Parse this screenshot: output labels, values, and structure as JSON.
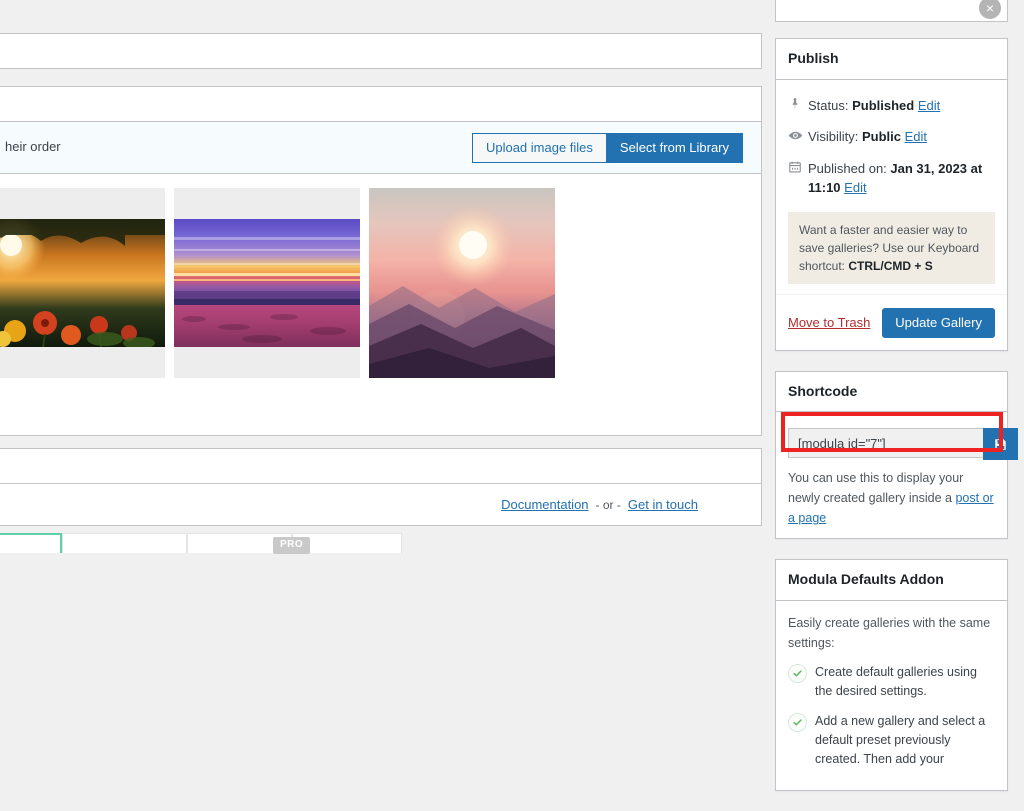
{
  "main": {
    "uploader": {
      "hint": "heir order",
      "upload_button": "Upload image files",
      "library_button": "Select from Library"
    },
    "gallery": {
      "images": [
        {
          "alt": "sunflowers-at-sunset"
        },
        {
          "alt": "beach-sunset-panorama"
        },
        {
          "alt": "mountain-sunset"
        }
      ]
    },
    "footer_links": {
      "documentation": "Documentation",
      "separator": "- or -",
      "contact": "Get in touch"
    },
    "tabs": {
      "pro_badge": "PRO"
    }
  },
  "sidebar": {
    "publish": {
      "title": "Publish",
      "rows": [
        {
          "icon": "pin-icon",
          "label": "Status:",
          "value": "Published",
          "edit": "Edit"
        },
        {
          "icon": "eye-icon",
          "label": "Visibility:",
          "value": "Public",
          "edit": "Edit"
        },
        {
          "icon": "calendar-icon",
          "label": "Published on:",
          "value": "Jan 31, 2023 at 11:10",
          "edit": "Edit"
        }
      ],
      "notice_text": "Want a faster and easier way to save galleries? Use our Keyboard shortcut:",
      "notice_shortcut": "CTRL/CMD + S",
      "trash_link": "Move to Trash",
      "update_button": "Update Gallery"
    },
    "shortcode": {
      "title": "Shortcode",
      "value": "[modula id=\"7\"]",
      "copy_icon": "save-icon",
      "help_prefix": "You can use this to display your newly created gallery inside a",
      "help_link": "post or a page",
      "highlight_color": "#ef2222"
    },
    "addon": {
      "title": "Modula Defaults Addon",
      "intro": "Easily create galleries with the same settings:",
      "items": [
        "Create default galleries using the desired settings.",
        "Add a new gallery and select a default preset previously created. Then add your"
      ]
    }
  },
  "overlay": {
    "close_icon": "×"
  },
  "colors": {
    "primary": "#2271b1",
    "danger": "#b32d2e",
    "highlight": "#ef2222",
    "tab_active": "#5ecfa6",
    "check_green": "#5cb85c"
  }
}
